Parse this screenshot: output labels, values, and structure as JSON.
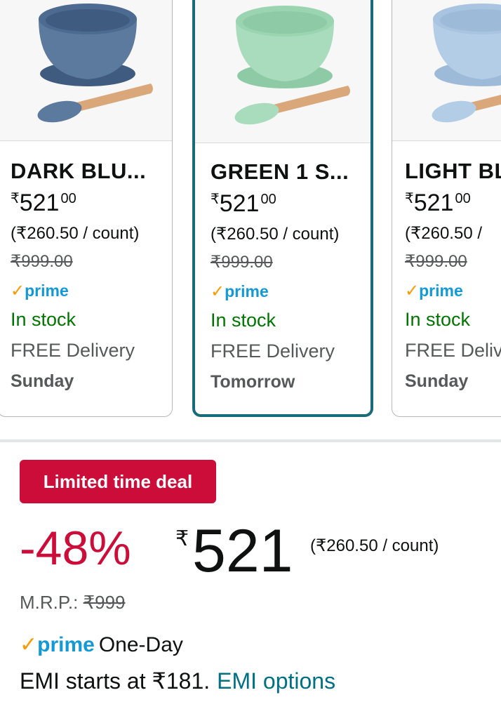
{
  "variants": [
    {
      "name": "DARK BLU...",
      "price_currency": "₹",
      "price_whole": "521",
      "price_fraction": "00",
      "unit_price": "(₹260.50 / count)",
      "mrp": "₹999.00",
      "prime_label": "prime",
      "stock": "In stock",
      "delivery": "FREE Delivery",
      "delivery_day": "Sunday",
      "selected": false,
      "color": "#5b7a9e"
    },
    {
      "name": "GREEN 1 S...",
      "price_currency": "₹",
      "price_whole": "521",
      "price_fraction": "00",
      "unit_price": "(₹260.50 / count)",
      "mrp": "₹999.00",
      "prime_label": "prime",
      "stock": "In stock",
      "delivery": "FREE Delivery",
      "delivery_day": "Tomorrow",
      "selected": true,
      "color": "#a8dcbc"
    },
    {
      "name": "LIGHT BL",
      "price_currency": "₹",
      "price_whole": "521",
      "price_fraction": "00",
      "unit_price": "(₹260.50 /",
      "mrp": "₹999.00",
      "prime_label": "prime",
      "stock": "In stock",
      "delivery": "FREE Deliv",
      "delivery_day": "Sunday",
      "selected": false,
      "color": "#b4cde6"
    }
  ],
  "deal": {
    "badge": "Limited time deal",
    "discount": "-48%",
    "currency": "₹",
    "price": "521",
    "unit_price": "(₹260.50 / count)",
    "mrp_label": "M.R.P.:",
    "mrp_value": "₹999",
    "prime_label": "prime",
    "prime_suffix": "One-Day",
    "emi_text": "EMI starts at ₹181.",
    "emi_link": "EMI options"
  },
  "colors": {
    "deal_red": "#cc0c39",
    "prime_blue": "#1399d6",
    "prime_check": "#ff9900",
    "in_stock_green": "#007600",
    "link_teal": "#007185",
    "selected_border": "#1a6b7a"
  },
  "icons": {
    "prime_check": "checkmark-icon",
    "product_image": "silicone-bowl-with-spoon"
  }
}
